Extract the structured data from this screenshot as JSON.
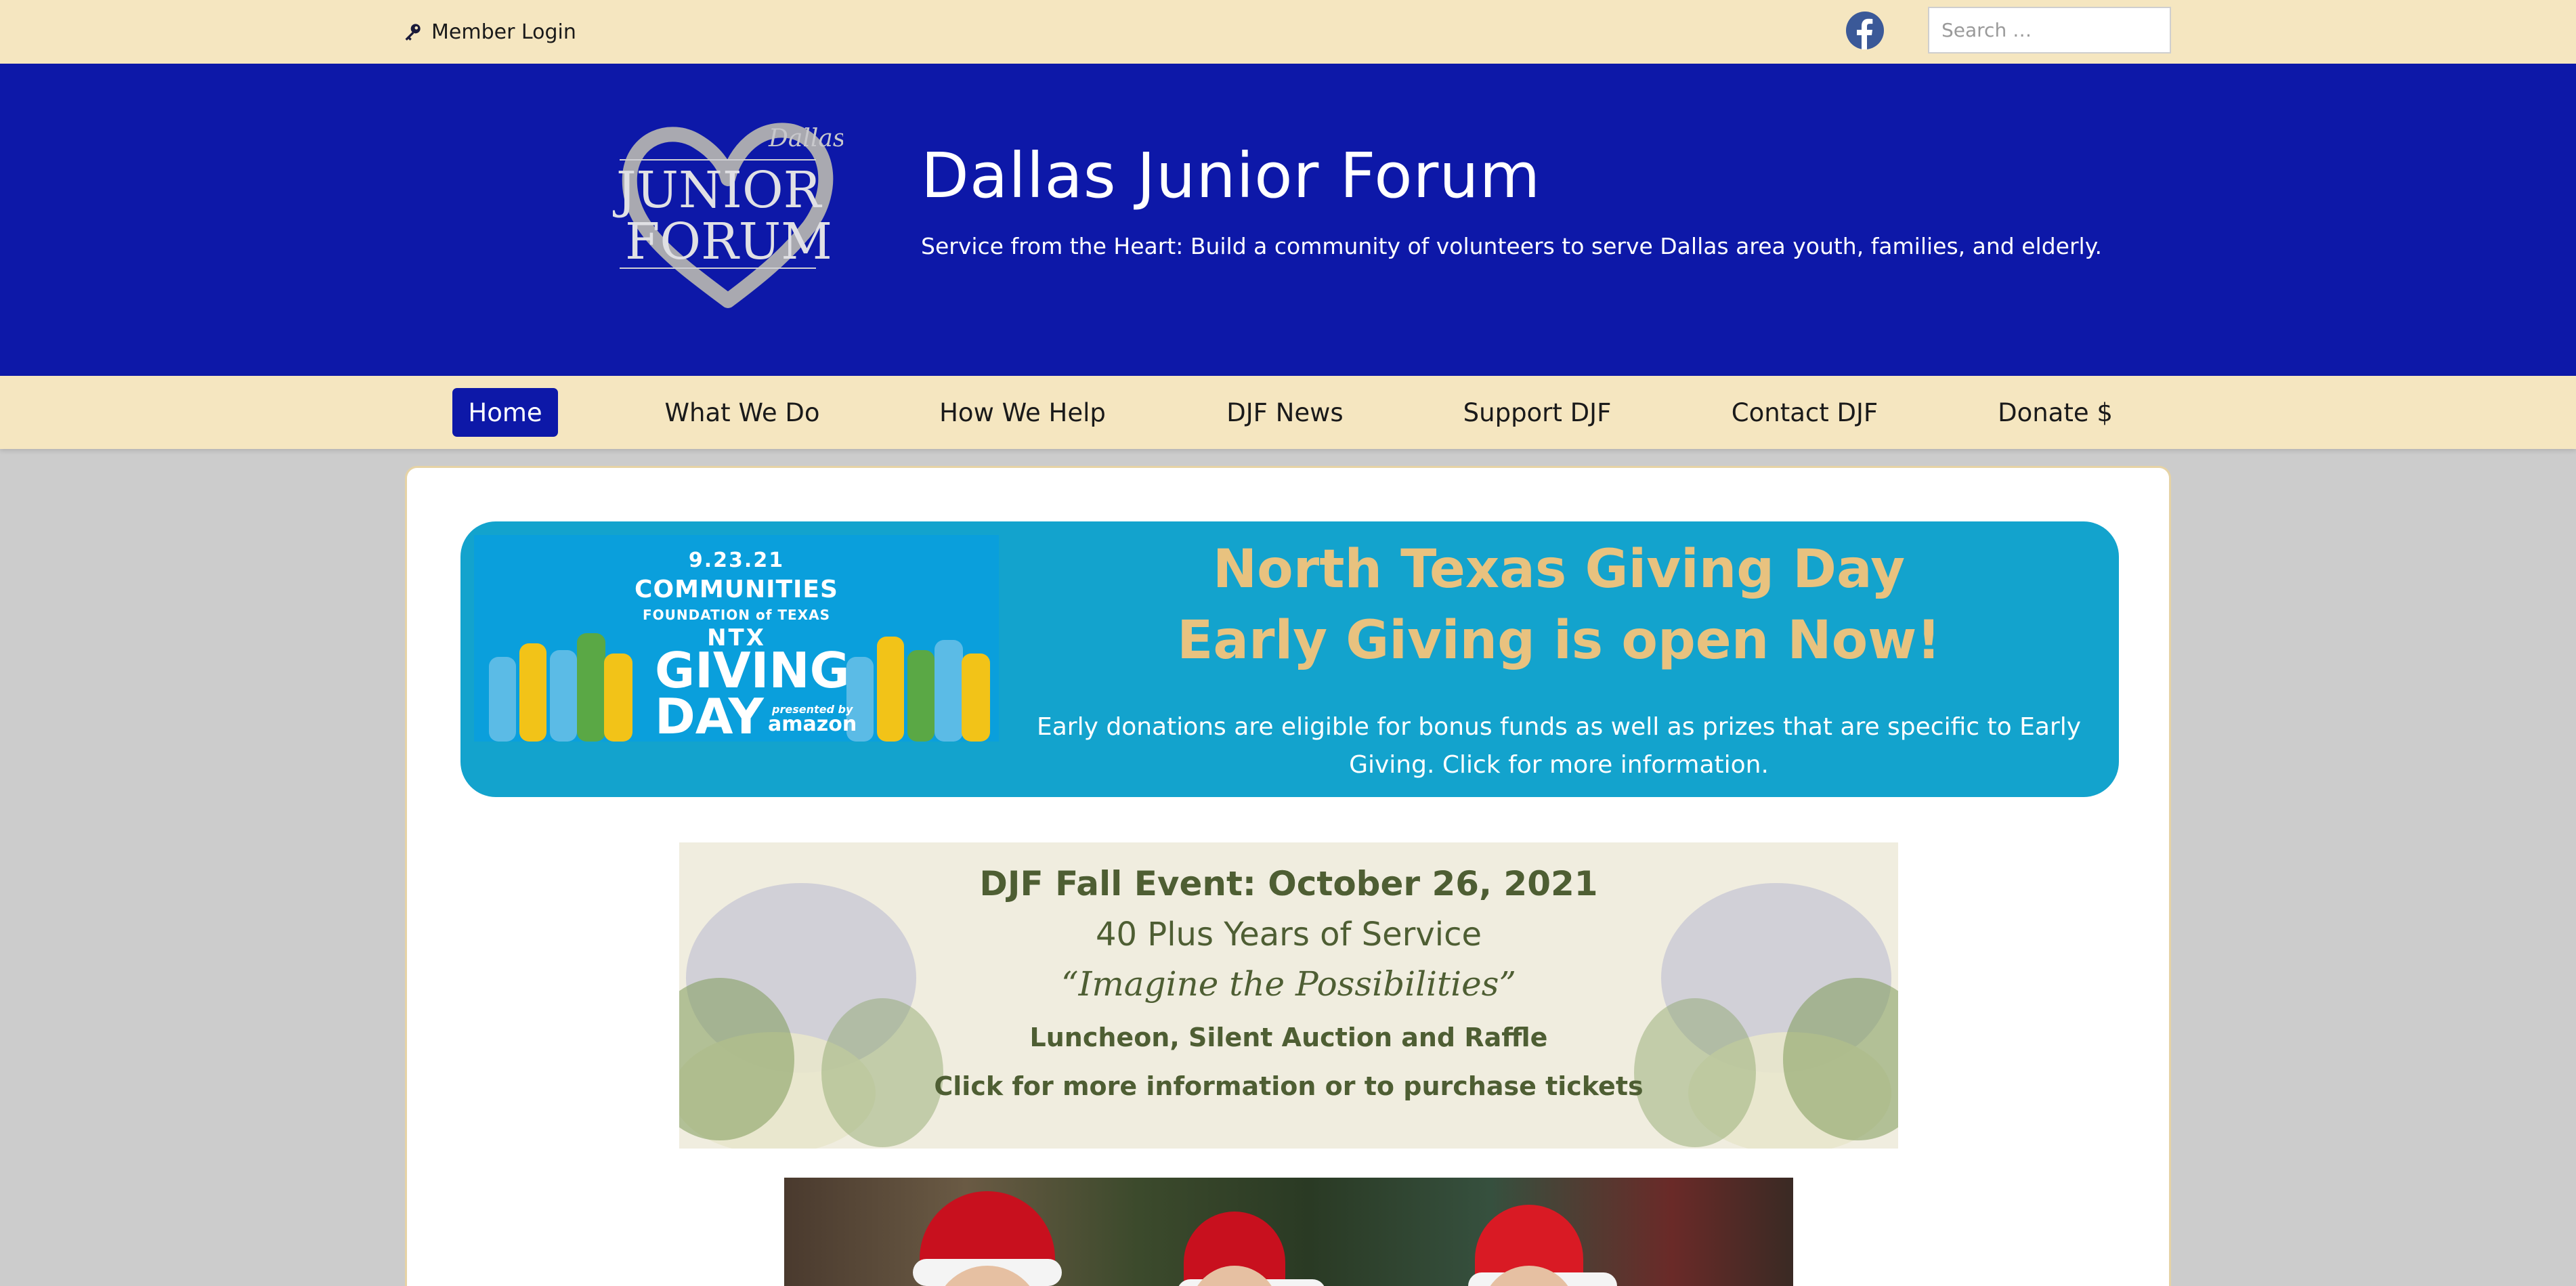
{
  "topbar": {
    "member_login": "Member Login",
    "search_placeholder": "Search …"
  },
  "header": {
    "site_title": "Dallas Junior Forum",
    "tagline": "Service from the Heart: Build a community of volunteers to serve Dallas area youth, families, and elderly.",
    "logo": {
      "dallas": "Dallas",
      "junior": "JUNIOR",
      "forum": "FORUM"
    }
  },
  "nav": {
    "items": [
      {
        "label": "Home",
        "active": true
      },
      {
        "label": "What We Do"
      },
      {
        "label": "How We Help"
      },
      {
        "label": "DJF News"
      },
      {
        "label": "Support DJF"
      },
      {
        "label": "Contact DJF"
      },
      {
        "label": "Donate $"
      }
    ]
  },
  "giving_banner": {
    "logo": {
      "date": "9.23.21",
      "org_line1": "COMMUNITIES",
      "org_line2": "FOUNDATION of TEXAS",
      "ntx": "NTX",
      "giving": "GIVING",
      "day": "DAY",
      "presented_by": "presented by",
      "sponsor": "amazon"
    },
    "title_line1": "North Texas Giving Day",
    "title_line2": "Early Giving is open Now!",
    "body": "Early donations are eligible for bonus funds as well as prizes that are specific to Early Giving. Click for more information."
  },
  "fall_event": {
    "line1": "DJF Fall Event: October 26, 2021",
    "line2": "40 Plus Years of Service",
    "line3": "“Imagine the Possibilities”",
    "line4": "Luncheon, Silent Auction and Raffle",
    "line5": "Click for more information or to purchase tickets"
  },
  "colors": {
    "topbar_bg": "#f5e6c0",
    "header_bg": "#0d18a8",
    "page_bg": "#cccccc",
    "giving_banner_bg": "#13a3cd",
    "giving_title": "#e8c27f",
    "fall_text": "#4e5e33"
  }
}
